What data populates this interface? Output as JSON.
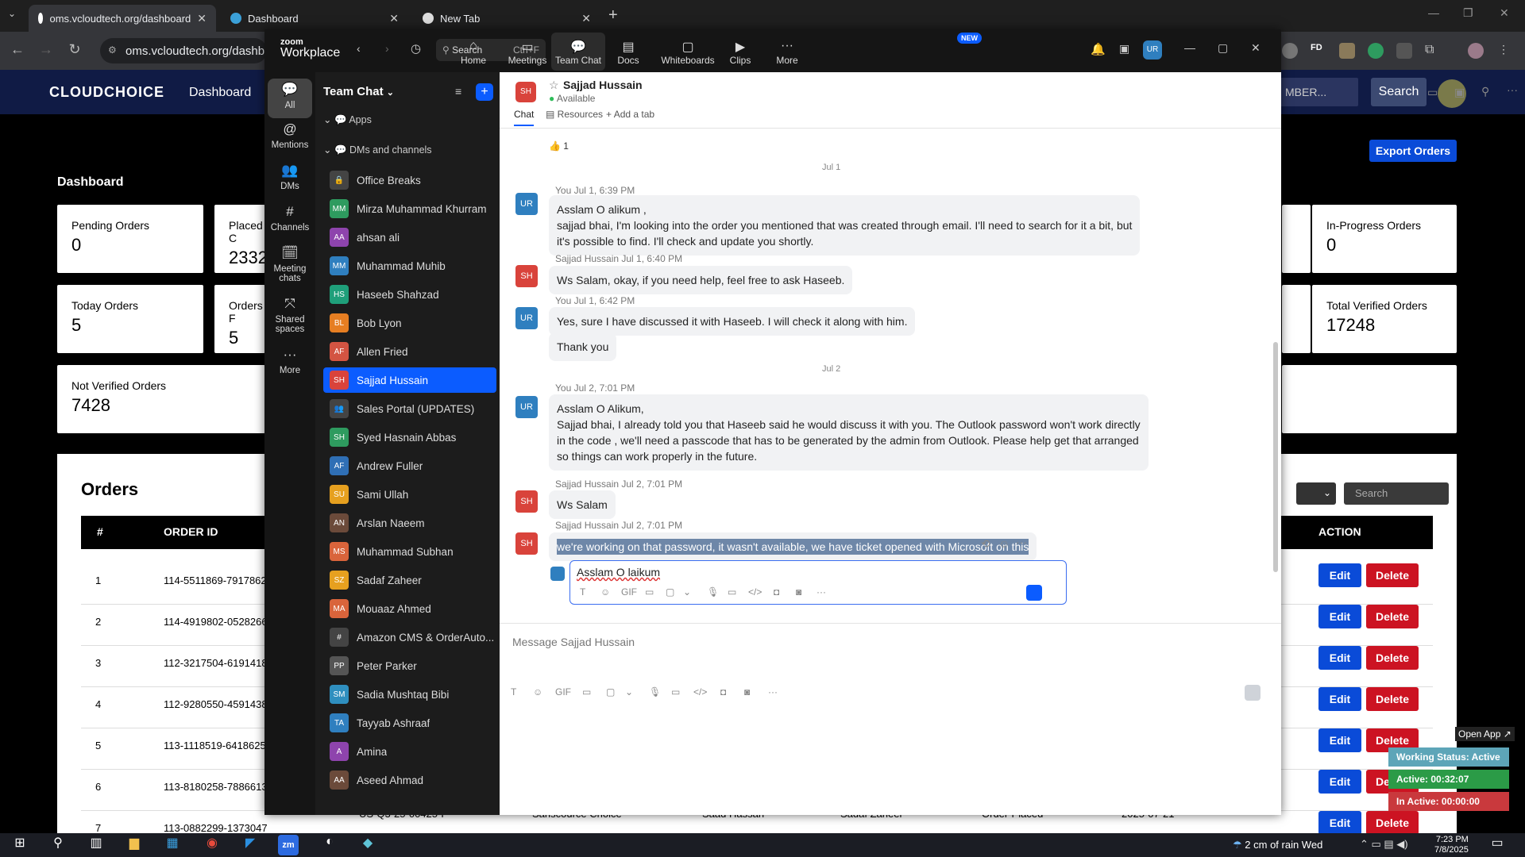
{
  "browser": {
    "tabs": [
      {
        "title": "oms.vcloudtech.org/dashboard"
      },
      {
        "title": "Dashboard"
      },
      {
        "title": "New Tab"
      }
    ],
    "url": "oms.vcloudtech.org/dashbo"
  },
  "site": {
    "logo": "CLOUDCHOICE",
    "nav_dashboard": "Dashboard",
    "search_placeholder": "MBER...",
    "search_button": "Search",
    "export_button": "Export Orders",
    "page_title": "Dashboard",
    "cards": [
      {
        "label": "Pending Orders",
        "value": "0"
      },
      {
        "label": "Placed C",
        "value": "2332"
      },
      {
        "label": "In-Progress Orders",
        "value": "0"
      },
      {
        "label": "Today Orders",
        "value": "5"
      },
      {
        "label": "Orders F",
        "value": "5"
      },
      {
        "label": "Total Verified Orders",
        "value": "17248"
      },
      {
        "label": "Not Verified Orders",
        "value": "7428"
      }
    ],
    "orders_title": "Orders",
    "orders_search_placeholder": "Search",
    "table_headers": [
      "#",
      "ORDER ID",
      "ACTION"
    ],
    "rows": [
      {
        "n": "1",
        "id": "114-5511869-7917862"
      },
      {
        "n": "2",
        "id": "114-4919802-0528266"
      },
      {
        "n": "3",
        "id": "112-3217504-6191418"
      },
      {
        "n": "4",
        "id": "112-9280550-4591438"
      },
      {
        "n": "5",
        "id": "113-1118519-6418625"
      },
      {
        "n": "6",
        "id": "113-8180258-7886613"
      },
      {
        "n": "7",
        "id": "113-0882299-1373047"
      }
    ],
    "edit_label": "Edit",
    "delete_label": "Delete",
    "partial_row": {
      "c1": "US-Q3-25-00425-P",
      "c2": "Sanscource Choice",
      "c3": "Saad Hassan",
      "c4": "Sadaf Zaheer",
      "c5": "Order-Placed",
      "c6": "2025-07-21"
    }
  },
  "status_widget": {
    "open_app": "Open App ↗",
    "working": "Working Status: Active",
    "active": "Active: 00:32:07",
    "inactive": "In Active: 00:00:00"
  },
  "zoom": {
    "brand_top": "zoom",
    "brand": "Workplace",
    "search": "Search",
    "shortcut": "Ctrl+F",
    "tabs": [
      {
        "label": "Home",
        "icon": "⌂"
      },
      {
        "label": "Meetings",
        "icon": "▭"
      },
      {
        "label": "Team Chat",
        "icon": "💬"
      },
      {
        "label": "Docs",
        "icon": "▤"
      },
      {
        "label": "Whiteboards",
        "icon": "▢"
      },
      {
        "label": "Clips",
        "icon": "▶"
      },
      {
        "label": "More",
        "icon": "···"
      }
    ],
    "new_badge": "NEW",
    "user_initials": "UR",
    "rail": [
      {
        "label": "All",
        "icon": "💬"
      },
      {
        "label": "Mentions",
        "icon": "@"
      },
      {
        "label": "DMs",
        "icon": "👥"
      },
      {
        "label": "Channels",
        "icon": "#"
      },
      {
        "label": "Meeting chats",
        "icon": "🗓"
      },
      {
        "label": "Shared spaces",
        "icon": "⤧"
      },
      {
        "label": "More",
        "icon": "···"
      }
    ],
    "list_title": "Team Chat",
    "section_apps": "Apps",
    "section_dms": "DMs and channels",
    "contacts": [
      {
        "name": "Office Breaks",
        "initials": "🔒",
        "color": "#444"
      },
      {
        "name": "Mirza Muhammad Khurram",
        "initials": "MM",
        "color": "#2e9b5f"
      },
      {
        "name": "ahsan ali",
        "initials": "AA",
        "color": "#8e44ad"
      },
      {
        "name": "Muhammad Muhib",
        "initials": "MM",
        "color": "#2f7fbf"
      },
      {
        "name": "Haseeb Shahzad",
        "initials": "HS",
        "color": "#1f9f7a"
      },
      {
        "name": "Bob Lyon",
        "initials": "BL",
        "color": "#e67e22"
      },
      {
        "name": "Allen Fried",
        "initials": "AF",
        "color": "#d35442"
      },
      {
        "name": "Sajjad Hussain",
        "initials": "SH",
        "color": "#d9433b"
      },
      {
        "name": "Sales Portal (UPDATES)",
        "initials": "👥",
        "color": "#444"
      },
      {
        "name": "Syed Hasnain Abbas",
        "initials": "SH",
        "color": "#2e9b5f"
      },
      {
        "name": "Andrew Fuller",
        "initials": "AF",
        "color": "#2f6fb5"
      },
      {
        "name": "Sami Ullah",
        "initials": "SU",
        "color": "#e6a01f"
      },
      {
        "name": "Arslan Naeem",
        "initials": "AN",
        "color": "#6b4a3a"
      },
      {
        "name": "Muhammad Subhan",
        "initials": "MS",
        "color": "#d9643b"
      },
      {
        "name": "Sadaf Zaheer",
        "initials": "SZ",
        "color": "#e6a01f"
      },
      {
        "name": "Mouaaz Ahmed",
        "initials": "MA",
        "color": "#d9643b"
      },
      {
        "name": "Amazon CMS & OrderAuto...",
        "initials": "#",
        "color": "#444"
      },
      {
        "name": "Peter Parker",
        "initials": "PP",
        "color": "#555"
      },
      {
        "name": "Sadia Mushtaq Bibi",
        "initials": "SM",
        "color": "#2f8fbf"
      },
      {
        "name": "Tayyab Ashraaf",
        "initials": "TA",
        "color": "#2f7fbf"
      },
      {
        "name": "Amina",
        "initials": "A",
        "color": "#8e44ad"
      },
      {
        "name": "Aseed Ahmad",
        "initials": "AA",
        "color": "#6b4a3a"
      }
    ],
    "chat": {
      "name": "Sajjad Hussain",
      "initials": "SH",
      "status": "Available",
      "tab_chat": "Chat",
      "tab_resources": "Resources",
      "tab_add": "Add a tab",
      "reaction": "👍 1",
      "date1": "Jul 1",
      "date2": "Jul 2",
      "messages": [
        {
          "initials": "UR",
          "meta": "You Jul 1, 6:39 PM",
          "lines": [
            "Asslam O alikum ,",
            "sajjad bhai, I'm looking into the order you mentioned that was created through email. I'll need to search for it a bit, but",
            "it's possible to find. I'll check and update you shortly."
          ]
        },
        {
          "initials": "SH",
          "meta": "Sajjad Hussain Jul 1, 6:40 PM",
          "lines": [
            "Ws Salam, okay, if you need help, feel free to ask Haseeb."
          ]
        },
        {
          "initials": "UR",
          "meta": "You Jul 1, 6:42 PM",
          "lines": [
            "Yes, sure  I have discussed it with Haseeb. I will check it along with him."
          ]
        },
        {
          "initials": "",
          "meta": "",
          "lines": [
            "Thank you"
          ]
        },
        {
          "initials": "UR",
          "meta": "You Jul 2, 7:01 PM",
          "lines": [
            "Asslam O Alikum,",
            "Sajjad bhai, I already told you that Haseeb said he would discuss it with you. The Outlook password won't work directly",
            "in the code , we'll need a passcode that has to be generated by the admin from Outlook. Please help get that arranged",
            "so things can work properly in the future."
          ]
        },
        {
          "initials": "SH",
          "meta": "Sajjad Hussain Jul 2, 7:01 PM",
          "lines": [
            "Ws Salam"
          ]
        },
        {
          "initials": "SH",
          "meta": "Sajjad Hussain Jul 2, 7:01 PM",
          "lines": [
            "we're working on that password, it wasn't available, we have ticket opened with Microsoft on this"
          ]
        }
      ],
      "reply_text": "Asslam O laikum",
      "message_placeholder": "Message Sajjad Hussain"
    }
  },
  "taskbar": {
    "weather": "2 cm of rain Wed",
    "time": "7:23 PM",
    "date": "7/8/2025"
  }
}
